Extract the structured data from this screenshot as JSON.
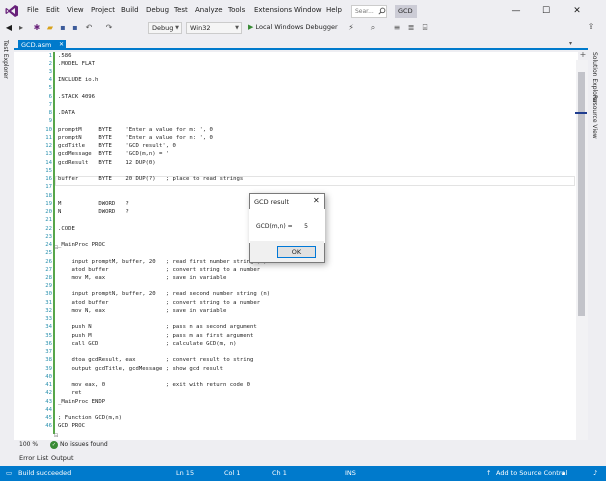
{
  "menu": {
    "items": [
      "File",
      "Edit",
      "View",
      "Project",
      "Build",
      "Debug",
      "Test",
      "Analyze",
      "Tools",
      "Extensions",
      "Window",
      "Help"
    ],
    "search_placeholder": "Sear...",
    "solution_name": "GCD"
  },
  "window_controls": {
    "minimize": "—",
    "maximize": "☐",
    "close": "✕"
  },
  "toolbar": {
    "configuration": "Debug",
    "platform": "Win32",
    "debugger_label": "Local Windows Debugger"
  },
  "left_strip": {
    "label": "Test Explorer"
  },
  "right_strip": {
    "label_1": "Solution Explorer",
    "label_2": "Resource View"
  },
  "editor": {
    "tab_label": "GCD.asm",
    "lines": [
      {
        "n": "1",
        "t": ".586"
      },
      {
        "n": "2",
        "t": ".MODEL FLAT"
      },
      {
        "n": "3",
        "t": ""
      },
      {
        "n": "4",
        "t": "INCLUDE io.h"
      },
      {
        "n": "5",
        "t": ""
      },
      {
        "n": "6",
        "t": ".STACK 4096"
      },
      {
        "n": "7",
        "t": ""
      },
      {
        "n": "8",
        "t": ".DATA"
      },
      {
        "n": "9",
        "t": ""
      },
      {
        "n": "10",
        "t": "promptM     BYTE    'Enter a value for m: ', 0"
      },
      {
        "n": "11",
        "t": "promptN     BYTE    'Enter a value for n: ', 0"
      },
      {
        "n": "12",
        "t": "gcdTitle    BYTE    'GCD result', 0"
      },
      {
        "n": "13",
        "t": "gcdMessage  BYTE    'GCD(m,n) = '"
      },
      {
        "n": "14",
        "t": "gcdResult   BYTE    12 DUP(0)"
      },
      {
        "n": "15",
        "t": ""
      },
      {
        "n": "16",
        "t": "buffer      BYTE    20 DUP(?)   ; place to read strings"
      },
      {
        "n": "17",
        "t": ""
      },
      {
        "n": "18",
        "t": ""
      },
      {
        "n": "19",
        "t": "M           DWORD   ?"
      },
      {
        "n": "20",
        "t": "N           DWORD   ?"
      },
      {
        "n": "21",
        "t": ""
      },
      {
        "n": "22",
        "t": ".CODE"
      },
      {
        "n": "23",
        "t": ""
      },
      {
        "n": "24",
        "t": "_MainProc PROC"
      },
      {
        "n": "25",
        "t": ""
      },
      {
        "n": "26",
        "t": "    input promptM, buffer, 20   ; read first number string (m)"
      },
      {
        "n": "27",
        "t": "    atod buffer                 ; convert string to a number"
      },
      {
        "n": "28",
        "t": "    mov M, eax                  ; save in variable"
      },
      {
        "n": "29",
        "t": ""
      },
      {
        "n": "30",
        "t": "    input promptN, buffer, 20   ; read second number string (n)"
      },
      {
        "n": "31",
        "t": "    atod buffer                 ; convert string to a number"
      },
      {
        "n": "32",
        "t": "    mov N, eax                  ; save in variable"
      },
      {
        "n": "33",
        "t": ""
      },
      {
        "n": "34",
        "t": "    push N                      ; pass n as second argument"
      },
      {
        "n": "35",
        "t": "    push M                      ; pass m as first argument"
      },
      {
        "n": "36",
        "t": "    call GCD                    ; calculate GCD(m, n)"
      },
      {
        "n": "37",
        "t": ""
      },
      {
        "n": "38",
        "t": "    dtoa gcdResult, eax         ; convert result to string"
      },
      {
        "n": "39",
        "t": "    output gcdTitle, gcdMessage ; show gcd result"
      },
      {
        "n": "40",
        "t": ""
      },
      {
        "n": "41",
        "t": "    mov eax, 0                  ; exit with return code 0"
      },
      {
        "n": "42",
        "t": "    ret"
      },
      {
        "n": "43",
        "t": "_MainProc ENDP"
      },
      {
        "n": "44",
        "t": ""
      },
      {
        "n": "45",
        "t": "; Function GCD(m,n)"
      },
      {
        "n": "46",
        "t": "GCD PROC"
      }
    ],
    "zoom": "100 %",
    "issues_text": "No issues found"
  },
  "bottom_tabs": [
    "Error List",
    "Output"
  ],
  "status_bar": {
    "message": "Build succeeded",
    "line": "Ln 15",
    "col": "Col 1",
    "ch": "Ch 1",
    "mode": "INS",
    "source_control": "Add to Source Control"
  },
  "dialog": {
    "title": "GCD result",
    "message": "GCD(m,n) =      5",
    "ok_label": "OK"
  },
  "colors": {
    "accent": "#007acc",
    "line_numbers": "#2b91af",
    "success_green": "#388a34"
  }
}
